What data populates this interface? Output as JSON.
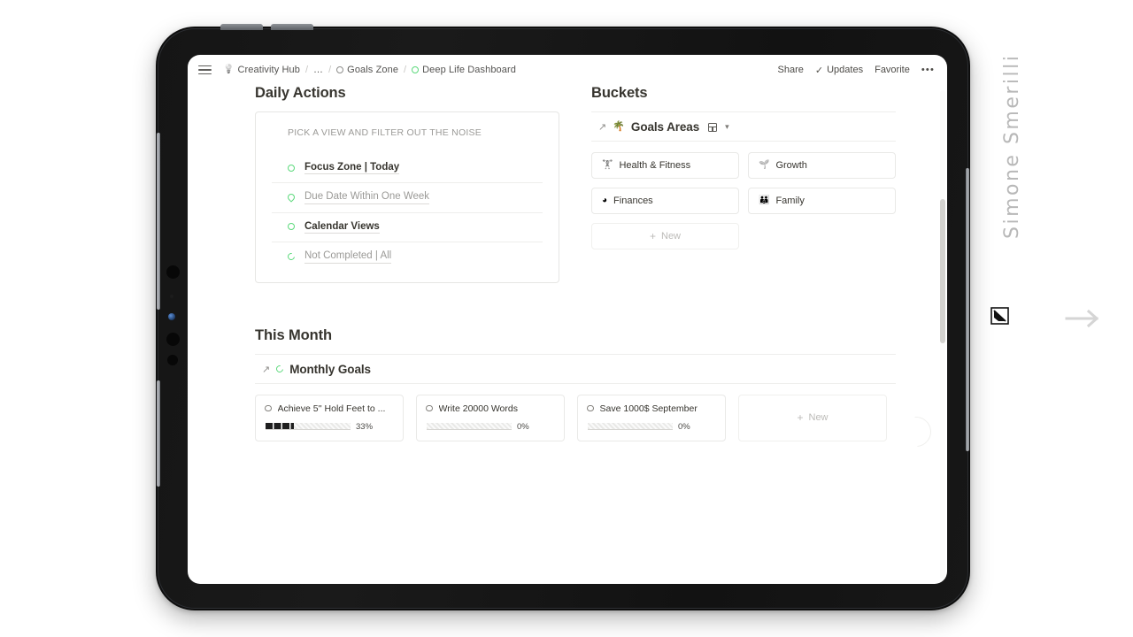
{
  "topbar": {
    "menu_icon": "hamburger-icon",
    "breadcrumbs": [
      {
        "icon": "lightbulb-icon",
        "label": "Creativity Hub"
      },
      {
        "icon": "none",
        "label": "…"
      },
      {
        "icon": "circle-icon",
        "label": "Goals Zone"
      },
      {
        "icon": "green-circle-icon",
        "label": "Deep Life Dashboard"
      }
    ],
    "separator": "/",
    "actions": {
      "share": "Share",
      "updates": "Updates",
      "updates_icon": "check-icon",
      "favorite": "Favorite",
      "more": "•••"
    }
  },
  "daily_actions": {
    "heading": "Daily Actions",
    "subtitle": "PICK A VIEW AND FILTER OUT THE NOISE",
    "rows": [
      {
        "icon": "green-circle-icon",
        "label": "Focus Zone | Today",
        "muted": false
      },
      {
        "icon": "green-drop-icon",
        "label": "Due Date Within One Week",
        "muted": true
      },
      {
        "icon": "green-circle-icon",
        "label": "Calendar Views",
        "muted": false
      },
      {
        "icon": "green-spinner-icon",
        "label": "Not Completed | All",
        "muted": true
      }
    ]
  },
  "buckets": {
    "heading": "Buckets",
    "database": {
      "open_icon": "arrow-up-right-icon",
      "emoji_icon": "tree-icon",
      "title": "Goals Areas",
      "view_icon": "table-view-icon",
      "chevron_icon": "chevron-down-icon"
    },
    "items": [
      {
        "icon": "weightlifting-icon",
        "label": "Health & Fitness"
      },
      {
        "icon": "seedling-icon",
        "label": "Growth"
      },
      {
        "icon": "pie-chart-icon",
        "label": "Finances"
      },
      {
        "icon": "family-icon",
        "label": "Family"
      }
    ],
    "new_label": "New",
    "new_icon": "plus-icon"
  },
  "this_month": {
    "heading": "This Month",
    "database": {
      "open_icon": "arrow-up-right-icon",
      "emoji_icon": "green-spinner-icon",
      "title": "Monthly Goals"
    },
    "goals": [
      {
        "icon": "circle-icon",
        "title": "Achieve 5'' Hold Feet to ...",
        "progress": 33,
        "progress_label": "33%"
      },
      {
        "icon": "circle-icon",
        "title": "Write 20000 Words",
        "progress": 0,
        "progress_label": "0%"
      },
      {
        "icon": "circle-icon",
        "title": "Save 1000$ September",
        "progress": 0,
        "progress_label": "0%"
      }
    ],
    "new_label": "New",
    "new_icon": "plus-icon"
  },
  "overlay": {
    "watermark": "Simone Smerilli",
    "cursor_icon": "cursor-icon",
    "next_icon": "arrow-right-icon"
  },
  "colors": {
    "accent_green": "#5bd97b",
    "text": "#37352f",
    "muted": "#9b9a97",
    "border": "#e9e9e7",
    "bar_fill": "#1f1f1f"
  }
}
